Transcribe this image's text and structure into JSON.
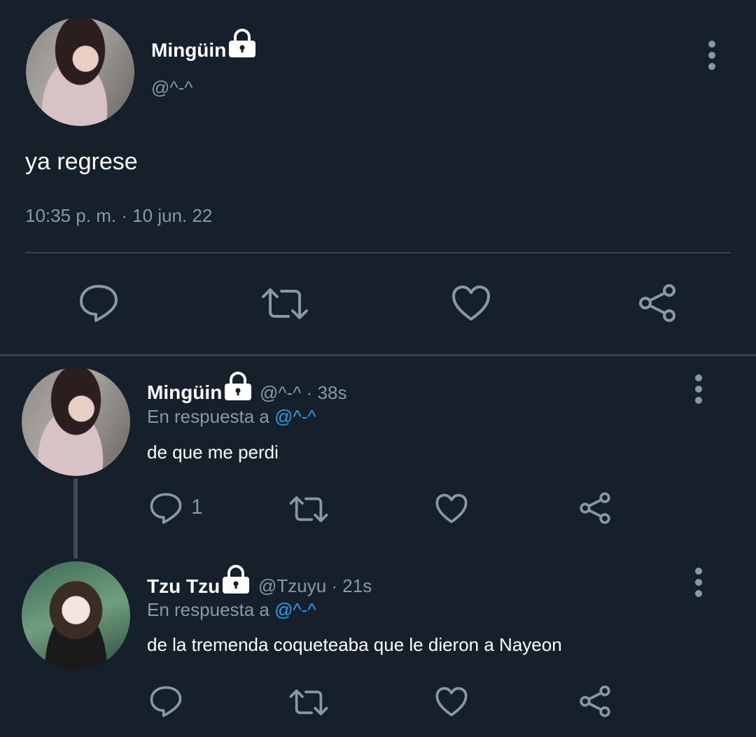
{
  "main_tweet": {
    "display_name": "Mingüin",
    "handle": "@^-^",
    "text": "ya regrese",
    "timestamp": "10:35 p. m. · 10 jun. 22"
  },
  "replies": [
    {
      "display_name": "Mingüin",
      "handle_time": "@^-^ · 38s",
      "reply_prefix": "En respuesta a",
      "reply_to": "@^-^",
      "text": "de que me perdi",
      "reply_count": "1"
    },
    {
      "display_name": "Tzu Tzu",
      "handle_time": "@Tzuyu · 21s",
      "reply_prefix": "En respuesta a",
      "reply_to": "@^-^",
      "text": "de la tremenda coqueteaba que le dieron a Nayeon",
      "reply_count": ""
    }
  ],
  "colors": {
    "background": "#15202b",
    "muted": "#8899a6",
    "link": "#1da1f2",
    "divider": "#38444d"
  },
  "icons": [
    "lock-icon",
    "more-icon",
    "reply-icon",
    "retweet-icon",
    "like-icon",
    "share-icon"
  ]
}
